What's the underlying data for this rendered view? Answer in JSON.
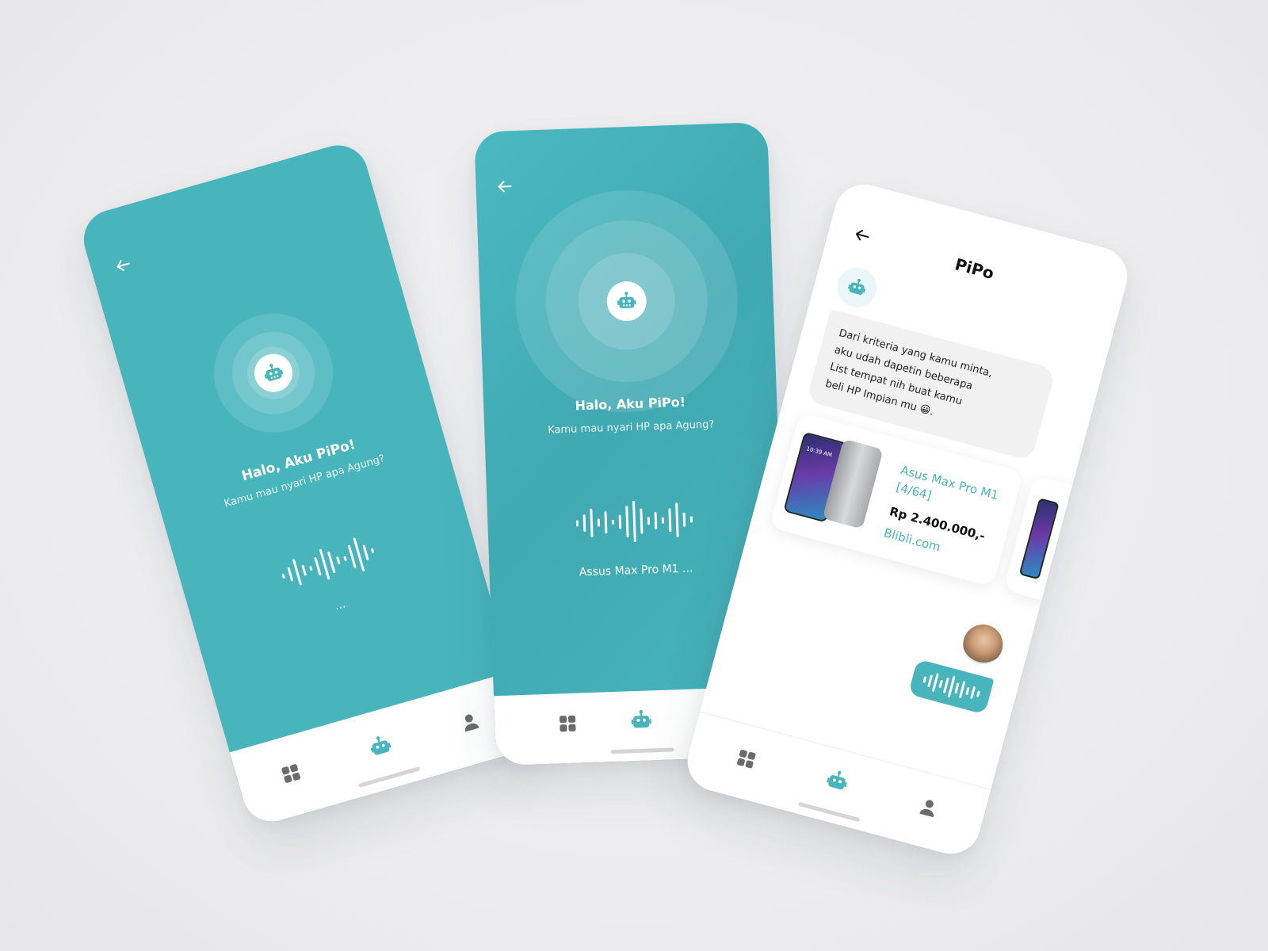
{
  "app": {
    "assistant_name": "PiPo",
    "accent": "#48b5bd"
  },
  "screen1": {
    "title": "Halo, Aku PiPo!",
    "subtitle": "Kamu mau nyari HP apa Agung?",
    "status": "..."
  },
  "screen2": {
    "title": "Halo, Aku PiPo!",
    "subtitle": "Kamu mau nyari HP apa Agung?",
    "transcript": "Assus Max Pro M1 ..."
  },
  "screen3": {
    "header_title": "PiPo",
    "bot_message_lines": [
      "Dari kriteria yang kamu minta,",
      "aku udah dapetin beberapa",
      "List tempat nih buat kamu",
      "beli HP Impian mu 😀."
    ],
    "product": {
      "name_line1": "Asus Max Pro M1",
      "name_line2": "[4/64]",
      "price": "Rp 2.400.000,-",
      "store": "Blibli.com",
      "phone_time": "10:39 AM"
    }
  },
  "nav": {
    "icons": [
      "grid-icon",
      "robot-icon",
      "profile-icon"
    ]
  }
}
